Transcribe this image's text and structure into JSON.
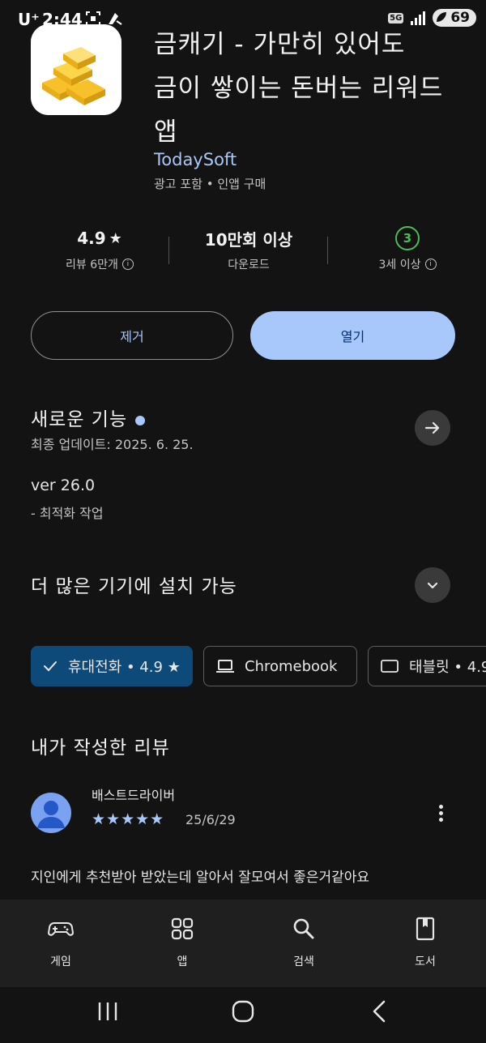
{
  "status_bar": {
    "carrier": "U⁺",
    "time": "2:44",
    "network": "5G",
    "battery": "69"
  },
  "app": {
    "title": "금캐기 - 가만히 있어도 금이 쌓이는 돈버는 리워드 앱",
    "title_lines": [
      "금캐기 - 가만히 있어도",
      "금이 쌓이는 돈버는 리워드",
      "앱"
    ],
    "developer": "TodaySoft",
    "meta": "광고 포함 • 인앱 구매"
  },
  "stats": {
    "rating": "4.9",
    "rating_label": "리뷰 6만개",
    "downloads": "10만회 이상",
    "downloads_label": "다운로드",
    "age_badge": "3",
    "age_label": "3세 이상"
  },
  "buttons": {
    "remove": "제거",
    "open": "열기"
  },
  "whats_new": {
    "title": "새로운 기능",
    "updated": "최종 업데이트: 2025. 6. 25.",
    "version": "ver 26.0",
    "note": "- 최적화 작업"
  },
  "devices": {
    "title": "더 많은 기기에 설치 가능",
    "chips": [
      {
        "label": "휴대전화 • 4.9 ★",
        "selected": true
      },
      {
        "label": "Chromebook",
        "selected": false
      },
      {
        "label": "태블릿 • 4.9",
        "selected": false
      }
    ]
  },
  "my_review": {
    "title": "내가 작성한 리뷰",
    "reviewer": "배스트드라이버",
    "stars": "★★★★★",
    "date": "25/6/29",
    "text": "지인에게 추천받아 받았는데 알아서 잘모여서 좋은거같아요"
  },
  "bottom_nav": [
    {
      "label": "게임",
      "icon": "gamepad-icon"
    },
    {
      "label": "앱",
      "icon": "apps-grid-icon"
    },
    {
      "label": "검색",
      "icon": "search-icon"
    },
    {
      "label": "도서",
      "icon": "book-icon"
    }
  ],
  "colors": {
    "background": "#131313",
    "accent": "#a8c7fa",
    "selected_chip": "#0d4a7a",
    "age_badge": "#4cbb5b"
  }
}
